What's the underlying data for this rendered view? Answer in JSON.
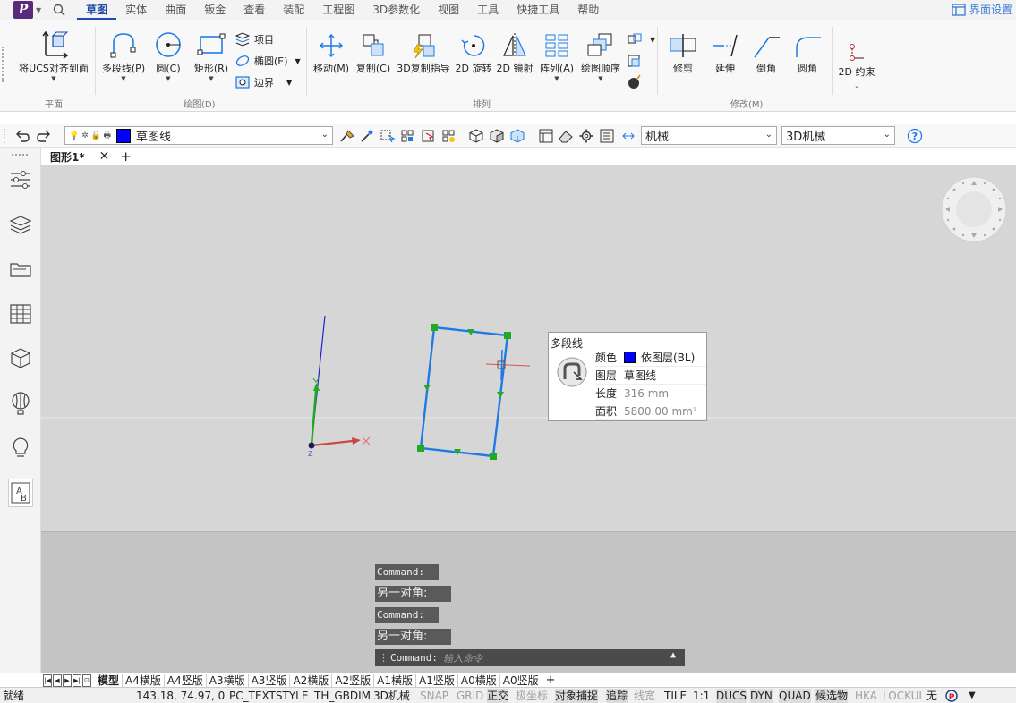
{
  "menu": {
    "tabs": [
      "草图",
      "实体",
      "曲面",
      "钣金",
      "查看",
      "装配",
      "工程图",
      "3D参数化",
      "视图",
      "工具",
      "快捷工具",
      "帮助"
    ],
    "active_tab": "草图",
    "ui_settings": "界面设置"
  },
  "ribbon": {
    "ucs": "将UCS对齐到面",
    "group_plane": "平面",
    "polyline": "多段线(P)",
    "circle": "圆(C)",
    "rectangle": "矩形(R)",
    "item": "项目",
    "ellipse": "椭圆(E)",
    "boundary": "边界",
    "group_draw": "绘图(D)",
    "move": "移动(M)",
    "copy": "复制(C)",
    "copy3d": "3D复制指导",
    "rotate2d": "2D 旋转",
    "mirror2d": "2D 镜射",
    "array": "阵列(A)",
    "draworder": "绘图顺序",
    "group_arrange": "排列",
    "trim": "修剪",
    "extend": "延伸",
    "chamfer": "倒角",
    "fillet": "圆角",
    "group_modify": "修改(M)",
    "constraint": "2D 约束"
  },
  "toolbar": {
    "layer": "草图线",
    "style": "机械",
    "view": "3D机械"
  },
  "doc": {
    "tab": "图形1*"
  },
  "tooltip": {
    "title": "多段线",
    "color_label": "颜色",
    "color_value": "依图层(BL)",
    "layer_label": "图层",
    "layer_value": "草图线",
    "length_label": "长度",
    "length_value": "316 mm",
    "area_label": "面积",
    "area_value": "5800.00 mm²"
  },
  "ucs_icon": {
    "z_label": "Z"
  },
  "command": {
    "history": [
      "Command:",
      "另一对角:",
      "Command:",
      "另一对角:"
    ],
    "prompt": "Command:",
    "placeholder": "输入命令"
  },
  "layouts": [
    "模型",
    "A4横版",
    "A4竖版",
    "A3横版",
    "A3竖版",
    "A2横版",
    "A2竖版",
    "A1横版",
    "A1竖版",
    "A0横版",
    "A0竖版"
  ],
  "status": {
    "ready": "就绪",
    "coords": "143.18, 74.97, 0",
    "textstyle": "PC_TEXTSTYLE",
    "dimstyle": "TH_GBDIM",
    "viewstyle": "3D机械",
    "snap": "SNAP",
    "grid": "GRID",
    "ortho": "正交",
    "polar": "极坐标",
    "osnap": "对象捕捉",
    "track": "追踪",
    "lineweight": "线宽",
    "tile": "TILE",
    "scale": "1:1",
    "ducs": "DUCS",
    "dyn": "DYN",
    "quad": "QUAD",
    "selcycle": "候选物",
    "hka": "HKA",
    "lockui": "LOCKUI",
    "none": "无"
  },
  "colors": {
    "accent": "#1f4aa8",
    "polyline": "#1e7be6",
    "layer_color": "#0000ff"
  }
}
